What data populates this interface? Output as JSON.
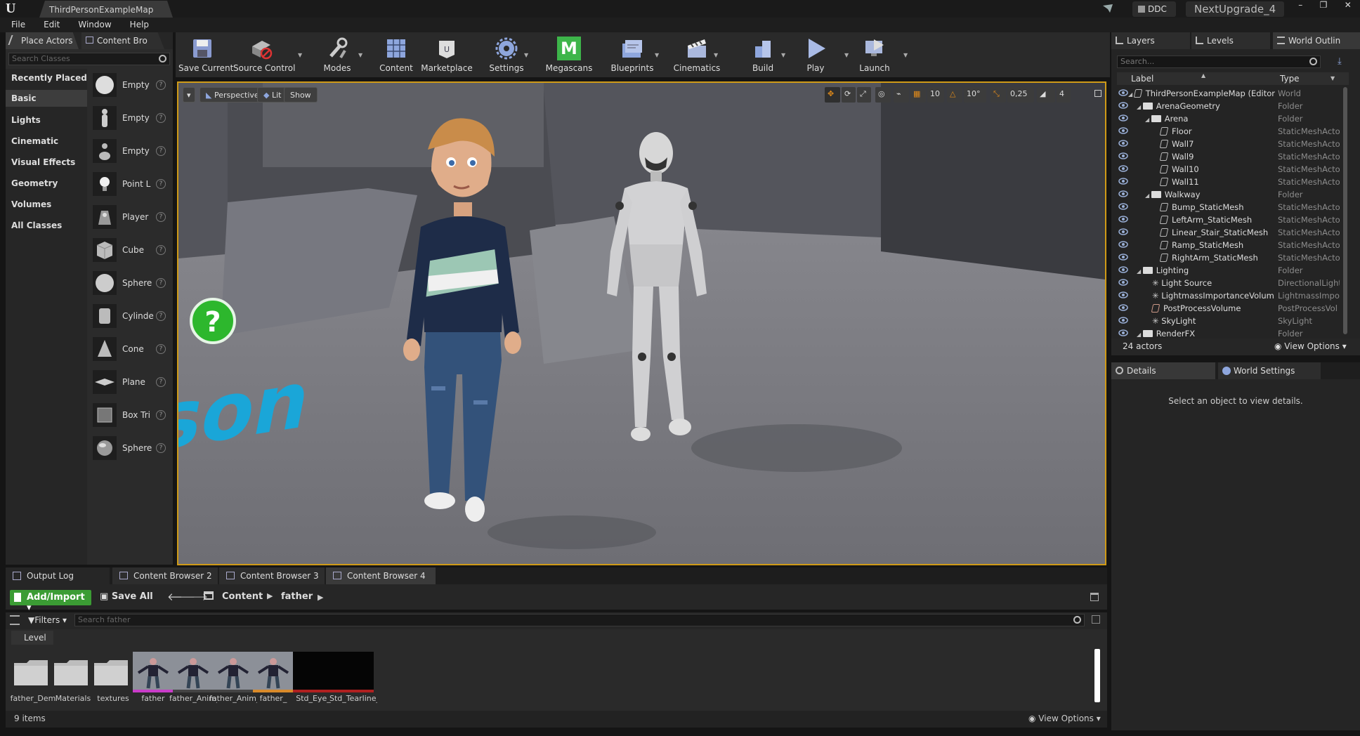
{
  "window": {
    "map_tab": "ThirdPersonExampleMap",
    "ddc_label": "DDC",
    "project_name": "NextUpgrade_4",
    "controls": [
      "–",
      "❐",
      "✕"
    ]
  },
  "menu": [
    "File",
    "Edit",
    "Window",
    "Help"
  ],
  "modes_panel": {
    "tabs": [
      "Place Actors",
      "Content Bro"
    ],
    "search_placeholder": "Search Classes",
    "categories": [
      "Recently Placed",
      "Basic",
      "Lights",
      "Cinematic",
      "Visual Effects",
      "Geometry",
      "Volumes",
      "All Classes"
    ],
    "selected_category": "Basic",
    "actors": [
      "Empty",
      "Empty",
      "Empty",
      "Point L",
      "Player",
      "Cube",
      "Sphere",
      "Cylinde",
      "Cone",
      "Plane",
      "Box Tri",
      "Sphere"
    ],
    "help_glyph": "?"
  },
  "toolbar": {
    "items": [
      "Save Current",
      "Source Control",
      "Modes",
      "Content",
      "Marketplace",
      "Settings",
      "Megascans",
      "Blueprints",
      "Cinematics",
      "Build",
      "Play",
      "Launch"
    ],
    "megascans_letter": "M"
  },
  "viewport": {
    "menu_glyph": "▾",
    "perspective": "Perspective",
    "lit": "Lit",
    "show": "Show",
    "grid_snap": "10",
    "rotation_snap": "10°",
    "scale_snap": "0,25",
    "camera_speed": "4",
    "floor_text": "erson"
  },
  "outliner": {
    "tabs": [
      "Layers",
      "Levels",
      "World Outlin"
    ],
    "search_placeholder": "Search...",
    "col_label": "Label",
    "col_type": "Type",
    "rows": [
      {
        "label": "ThirdPersonExampleMap (Editor",
        "type": "World",
        "indent": 0,
        "kind": "world"
      },
      {
        "label": "ArenaGeometry",
        "type": "Folder",
        "indent": 1,
        "kind": "folder"
      },
      {
        "label": "Arena",
        "type": "Folder",
        "indent": 2,
        "kind": "folder"
      },
      {
        "label": "Floor",
        "type": "StaticMeshActo",
        "indent": 3,
        "kind": "mesh"
      },
      {
        "label": "Wall7",
        "type": "StaticMeshActo",
        "indent": 3,
        "kind": "mesh"
      },
      {
        "label": "Wall9",
        "type": "StaticMeshActo",
        "indent": 3,
        "kind": "mesh"
      },
      {
        "label": "Wall10",
        "type": "StaticMeshActo",
        "indent": 3,
        "kind": "mesh"
      },
      {
        "label": "Wall11",
        "type": "StaticMeshActo",
        "indent": 3,
        "kind": "mesh"
      },
      {
        "label": "Walkway",
        "type": "Folder",
        "indent": 2,
        "kind": "folder"
      },
      {
        "label": "Bump_StaticMesh",
        "type": "StaticMeshActo",
        "indent": 3,
        "kind": "mesh"
      },
      {
        "label": "LeftArm_StaticMesh",
        "type": "StaticMeshActo",
        "indent": 3,
        "kind": "mesh"
      },
      {
        "label": "Linear_Stair_StaticMesh",
        "type": "StaticMeshActo",
        "indent": 3,
        "kind": "mesh"
      },
      {
        "label": "Ramp_StaticMesh",
        "type": "StaticMeshActo",
        "indent": 3,
        "kind": "mesh"
      },
      {
        "label": "RightArm_StaticMesh",
        "type": "StaticMeshActo",
        "indent": 3,
        "kind": "mesh"
      },
      {
        "label": "Lighting",
        "type": "Folder",
        "indent": 1,
        "kind": "folder"
      },
      {
        "label": "Light Source",
        "type": "DirectionalLight",
        "indent": 2,
        "kind": "light"
      },
      {
        "label": "LightmassImportanceVolum",
        "type": "LightmassImpo",
        "indent": 2,
        "kind": "light"
      },
      {
        "label": "PostProcessVolume",
        "type": "PostProcessVol",
        "indent": 2,
        "kind": "volume"
      },
      {
        "label": "SkyLight",
        "type": "SkyLight",
        "indent": 2,
        "kind": "light"
      },
      {
        "label": "RenderFX",
        "type": "Folder",
        "indent": 1,
        "kind": "folder"
      }
    ],
    "actor_count": "24 actors",
    "view_options": "View Options"
  },
  "details": {
    "tabs": [
      "Details",
      "World Settings"
    ],
    "empty_message": "Select an object to view details."
  },
  "bottom_tabs": [
    "Output Log",
    "Content Browser 2",
    "Content Browser 3",
    "Content Browser 4"
  ],
  "content_browser": {
    "add_import": "Add/Import",
    "save_all": "Save All",
    "path": [
      "Content",
      "father"
    ],
    "filters": "Filters",
    "search_placeholder": "Search father",
    "level_label": "Level",
    "assets": [
      {
        "name": "father_Dem",
        "kind": "folder"
      },
      {
        "name": "Materials",
        "kind": "folder"
      },
      {
        "name": "textures",
        "kind": "folder"
      },
      {
        "name": "father",
        "kind": "mesh",
        "underline": "#c93cc9"
      },
      {
        "name": "father_Anim_",
        "kind": "mesh",
        "underline": "#444444"
      },
      {
        "name": "father_Anim_",
        "kind": "mesh",
        "underline": "#444444"
      },
      {
        "name": "father_",
        "kind": "mesh",
        "underline": "#d98a2a"
      },
      {
        "name": "Std_Eye_",
        "kind": "dark",
        "underline": "#b02020"
      },
      {
        "name": "Std_Tearline_",
        "kind": "dark",
        "underline": "#b02020"
      }
    ],
    "item_count": "9 items",
    "view_options": "View Options"
  },
  "colors": {
    "accent_border": "#cf9a17",
    "add_button": "#3b9c34",
    "megascans": "#3db54a"
  }
}
